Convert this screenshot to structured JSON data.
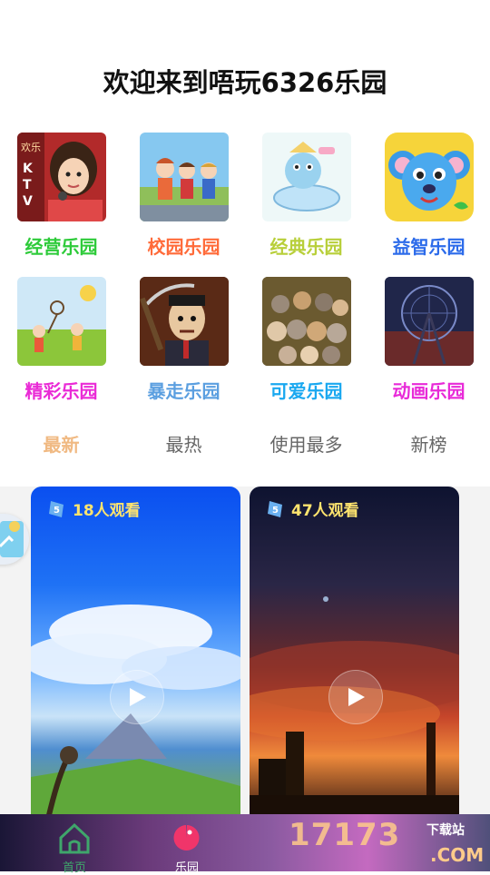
{
  "header": {
    "title": "欢迎来到唔玩6326乐园"
  },
  "categories": [
    {
      "label": "经营乐园",
      "color": "#2ecb3a",
      "thumb_text": "欢乐 KTV"
    },
    {
      "label": "校园乐园",
      "color": "#ff6b3a",
      "thumb_text": ""
    },
    {
      "label": "经典乐园",
      "color": "#b8cf3a",
      "thumb_text": ""
    },
    {
      "label": "益智乐园",
      "color": "#2c6bea",
      "thumb_text": ""
    },
    {
      "label": "精彩乐园",
      "color": "#ea2bd6",
      "thumb_text": ""
    },
    {
      "label": "暴走乐园",
      "color": "#5b9fe0",
      "thumb_text": ""
    },
    {
      "label": "可爱乐园",
      "color": "#1aa8f0",
      "thumb_text": ""
    },
    {
      "label": "动画乐园",
      "color": "#e82ad8",
      "thumb_text": ""
    }
  ],
  "tabs": [
    {
      "label": "最新",
      "active": true
    },
    {
      "label": "最热",
      "active": false
    },
    {
      "label": "使用最多",
      "active": false
    },
    {
      "label": "新榜",
      "active": false
    }
  ],
  "videos": [
    {
      "viewers": "18人观看"
    },
    {
      "viewers": "47人观看"
    }
  ],
  "bottom_nav": [
    {
      "label": "首页",
      "icon": "home-icon",
      "active": true
    },
    {
      "label": "乐园",
      "icon": "pacman-icon",
      "active": false
    }
  ],
  "watermark": {
    "main": "17173",
    "sub": "下载站",
    "com": ".COM"
  },
  "colors": {
    "active_tab": "#f0b982",
    "viewer_text": "#ffe46e",
    "nav_active": "#3fa66b"
  }
}
